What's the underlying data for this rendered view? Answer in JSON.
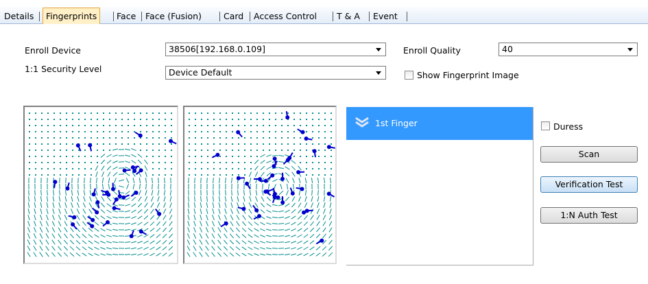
{
  "tabs": [
    {
      "label": "Details",
      "active": false
    },
    {
      "label": "Fingerprints",
      "active": true
    },
    {
      "label": "Face",
      "active": false
    },
    {
      "label": "Face (Fusion)",
      "active": false
    },
    {
      "label": "Card",
      "active": false
    },
    {
      "label": "Access Control",
      "active": false
    },
    {
      "label": "T & A",
      "active": false
    },
    {
      "label": "Event",
      "active": false
    }
  ],
  "form": {
    "enroll_device_label": "Enroll Device",
    "enroll_device_value": "38506[192.168.0.109]",
    "security_level_label": "1:1 Security Level",
    "security_level_value": "Device Default",
    "enroll_quality_label": "Enroll Quality",
    "enroll_quality_value": "40",
    "show_image_label": "Show Fingerprint Image",
    "show_image_checked": false
  },
  "finger_list": {
    "selected": "1st Finger",
    "icon": "double-chevron-down-icon"
  },
  "duress": {
    "label": "Duress",
    "checked": false
  },
  "buttons": {
    "scan": "Scan",
    "verification": "Verification Test",
    "auth": "1:N Auth Test"
  },
  "colors": {
    "tab_active_bg": "#fff0c8",
    "selection": "#3399ff",
    "ridge": "#008b8b",
    "minutia": "#0000cc"
  }
}
